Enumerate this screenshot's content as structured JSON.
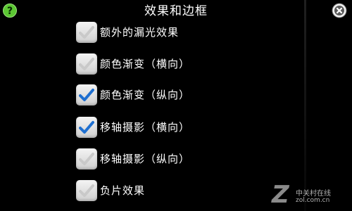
{
  "header": {
    "title": "效果和边框",
    "help_label": "?"
  },
  "options": [
    {
      "label": "额外的漏光效果",
      "checked": false
    },
    {
      "label": "颜色渐变（横向）",
      "checked": false
    },
    {
      "label": "颜色渐变（纵向）",
      "checked": true
    },
    {
      "label": "移轴摄影（横向）",
      "checked": true
    },
    {
      "label": "移轴摄影（纵向）",
      "checked": false
    },
    {
      "label": "负片效果",
      "checked": false
    }
  ],
  "colors": {
    "background": "#000000",
    "check_active": "#1e6fd0",
    "check_inactive": "#c9c9c9",
    "help_button": "#5cc733"
  },
  "icons": {
    "help": "question-mark-icon",
    "close": "close-icon",
    "check": "checkmark-icon"
  },
  "watermark": {
    "logo": "Z",
    "text_cn": "中关村在线",
    "url": "zol.com.cn"
  }
}
